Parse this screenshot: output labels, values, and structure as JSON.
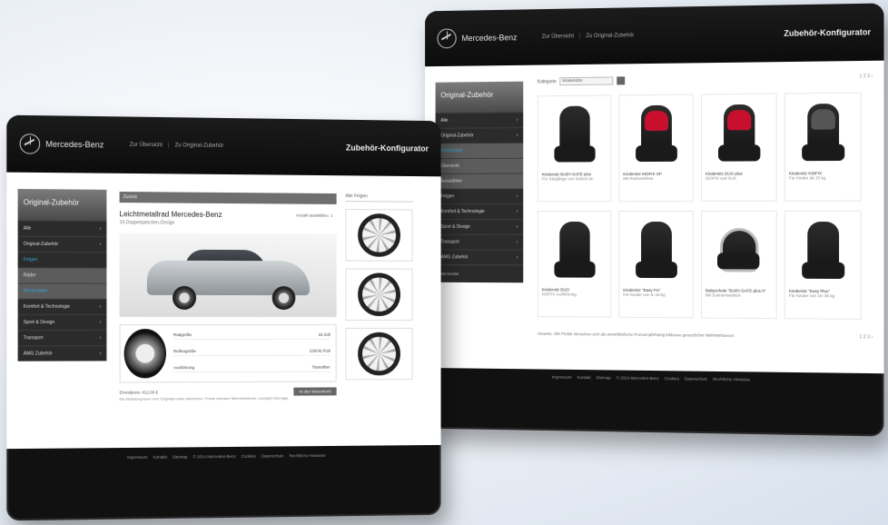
{
  "back": {
    "brand": "Mercedes-Benz",
    "crumbs": [
      "Zur Übersicht",
      "Zu Original-Zubehör"
    ],
    "title": "Zubehör-Konfigurator",
    "sidebar_head": "Original-Zubehör",
    "sidebar_items": [
      "Alle",
      "Original-Zubehör",
      "Kindersitze",
      "Übersicht",
      "Auswählen",
      "Felgen",
      "Komfort & Technologie",
      "Sport & Design",
      "Transport",
      "AMG Zubehör",
      "Merkzettel"
    ],
    "filter_label": "Kategorie",
    "filter_value": "Kindersitze",
    "pager": "1 2 3 ›",
    "products": [
      {
        "title": "Kindersitz BABY-SAFE plus",
        "desc": "Für Säuglinge von Geburt an",
        "color": "dark"
      },
      {
        "title": "Kindersitz KIDFIX XP",
        "desc": "Mit Rückenlehne",
        "color": "red"
      },
      {
        "title": "Kindersitz DUO plus",
        "desc": "ISOFIX und Gurt",
        "color": "red"
      },
      {
        "title": "Kindersitz KIDFIX",
        "desc": "Für Kinder ab 15 kg",
        "color": "grey"
      },
      {
        "title": "Kindersitz DUO",
        "desc": "ISOFIX Ausführung",
        "color": "dark"
      },
      {
        "title": "Kindersitz \"Easy Fix\"",
        "desc": "Für Kinder von 9–18 kg",
        "color": "dark"
      },
      {
        "title": "Babyschale \"BABY-SAFE plus II\"",
        "desc": "Mit Sonnenverdeck",
        "color": "carrier"
      },
      {
        "title": "Kindersitz \"Easy Plus\"",
        "desc": "Für Kinder von 15–36 kg",
        "color": "dark"
      }
    ],
    "note": "Hinweis: Alle Preise verstehen sich als unverbindliche Preisempfehlung inklusive gesetzlicher Mehrwertsteuer.",
    "pager_bottom": "1 2 3 ›",
    "footer": [
      "Impressum",
      "Kontakt",
      "Sitemap",
      "© 2014 Mercedes-Benz",
      "Cookies",
      "Datenschutz",
      "Rechtliche Hinweise"
    ]
  },
  "front": {
    "brand": "Mercedes-Benz",
    "crumbs": [
      "Zur Übersicht",
      "Zu Original-Zubehör"
    ],
    "title": "Zubehör-Konfigurator",
    "sidebar_head": "Original-Zubehör",
    "sidebar_items": [
      "Alle",
      "Original-Zubehör",
      "Felgen",
      "Räder",
      "Winterräder",
      "Komfort & Technologie",
      "Sport & Design",
      "Transport",
      "AMG Zubehör"
    ],
    "panel_bar": "Zurück",
    "product_title": "Leichtmetallrad Mercedes-Benz",
    "product_sub": "10-Doppelspeichen-Design",
    "count_label": "Anzahl auswählen: 1",
    "specs": [
      {
        "label": "Radgröße",
        "value": "18 Zoll"
      },
      {
        "label": "Reifengröße",
        "value": "225/45 R18"
      },
      {
        "label": "Ausführung",
        "value": "Titansilber"
      }
    ],
    "order_label": "Einzelpreis: 412,00 €",
    "cart_label": "In den Warenkorb",
    "rims_title": "Alle Felgen",
    "note": "Die Abbildung kann vom Originalprodukt abweichen. Preise inklusive Mehrwertsteuer, zuzüglich Montage.",
    "footer": [
      "Impressum",
      "Kontakt",
      "Sitemap",
      "© 2014 Mercedes-Benz",
      "Cookies",
      "Datenschutz",
      "Rechtliche Hinweise"
    ]
  }
}
